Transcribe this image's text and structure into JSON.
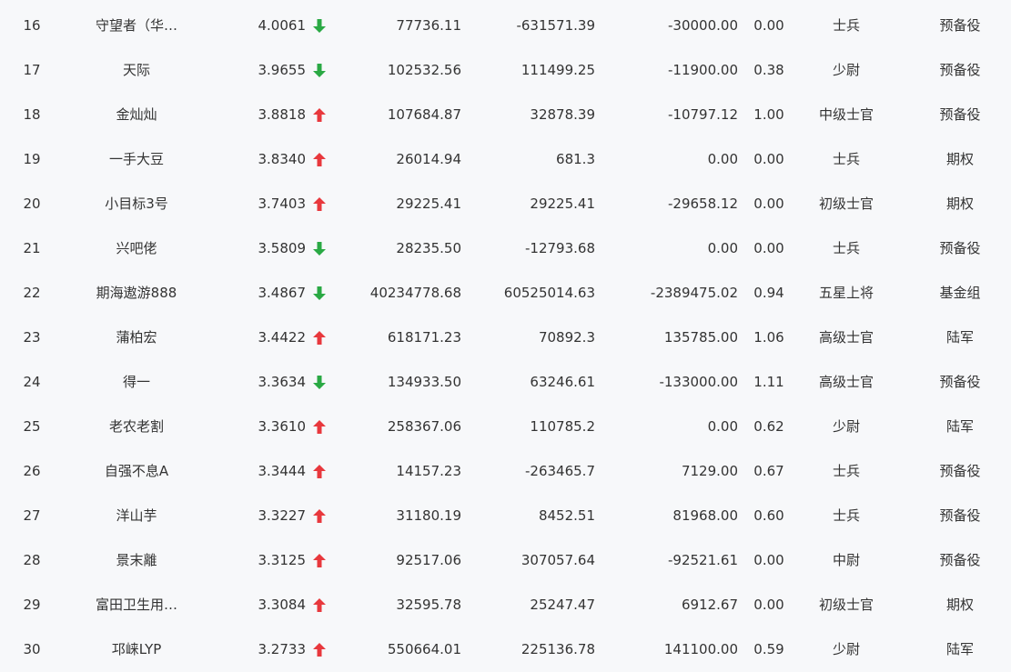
{
  "colors": {
    "up": "#e8383d",
    "down": "#2aa944",
    "text": "#333333",
    "background": "#f7f8fa"
  },
  "rows": [
    {
      "rank": "16",
      "name": "守望者（华…",
      "score": "4.0061",
      "trend": "down",
      "v1": "77736.11",
      "v2": "-631571.39",
      "v3": "-30000.00",
      "ratio": "0.00",
      "title": "士兵",
      "group": "预备役"
    },
    {
      "rank": "17",
      "name": "天际",
      "score": "3.9655",
      "trend": "down",
      "v1": "102532.56",
      "v2": "111499.25",
      "v3": "-11900.00",
      "ratio": "0.38",
      "title": "少尉",
      "group": "预备役"
    },
    {
      "rank": "18",
      "name": "金灿灿",
      "score": "3.8818",
      "trend": "up",
      "v1": "107684.87",
      "v2": "32878.39",
      "v3": "-10797.12",
      "ratio": "1.00",
      "title": "中级士官",
      "group": "预备役"
    },
    {
      "rank": "19",
      "name": "一手大豆",
      "score": "3.8340",
      "trend": "up",
      "v1": "26014.94",
      "v2": "681.3",
      "v3": "0.00",
      "ratio": "0.00",
      "title": "士兵",
      "group": "期权"
    },
    {
      "rank": "20",
      "name": "小目标3号",
      "score": "3.7403",
      "trend": "up",
      "v1": "29225.41",
      "v2": "29225.41",
      "v3": "-29658.12",
      "ratio": "0.00",
      "title": "初级士官",
      "group": "期权"
    },
    {
      "rank": "21",
      "name": "兴吧佬",
      "score": "3.5809",
      "trend": "down",
      "v1": "28235.50",
      "v2": "-12793.68",
      "v3": "0.00",
      "ratio": "0.00",
      "title": "士兵",
      "group": "预备役"
    },
    {
      "rank": "22",
      "name": "期海遨游888",
      "score": "3.4867",
      "trend": "down",
      "v1": "40234778.68",
      "v2": "60525014.63",
      "v3": "-2389475.02",
      "ratio": "0.94",
      "title": "五星上将",
      "group": "基金组"
    },
    {
      "rank": "23",
      "name": "蒲柏宏",
      "score": "3.4422",
      "trend": "up",
      "v1": "618171.23",
      "v2": "70892.3",
      "v3": "135785.00",
      "ratio": "1.06",
      "title": "高级士官",
      "group": "陆军"
    },
    {
      "rank": "24",
      "name": "得一",
      "score": "3.3634",
      "trend": "down",
      "v1": "134933.50",
      "v2": "63246.61",
      "v3": "-133000.00",
      "ratio": "1.11",
      "title": "高级士官",
      "group": "预备役"
    },
    {
      "rank": "25",
      "name": "老农老割",
      "score": "3.3610",
      "trend": "up",
      "v1": "258367.06",
      "v2": "110785.2",
      "v3": "0.00",
      "ratio": "0.62",
      "title": "少尉",
      "group": "陆军"
    },
    {
      "rank": "26",
      "name": "自强不息A",
      "score": "3.3444",
      "trend": "up",
      "v1": "14157.23",
      "v2": "-263465.7",
      "v3": "7129.00",
      "ratio": "0.67",
      "title": "士兵",
      "group": "预备役"
    },
    {
      "rank": "27",
      "name": "洋山芋",
      "score": "3.3227",
      "trend": "up",
      "v1": "31180.19",
      "v2": "8452.51",
      "v3": "81968.00",
      "ratio": "0.60",
      "title": "士兵",
      "group": "预备役"
    },
    {
      "rank": "28",
      "name": "景末離",
      "score": "3.3125",
      "trend": "up",
      "v1": "92517.06",
      "v2": "307057.64",
      "v3": "-92521.61",
      "ratio": "0.00",
      "title": "中尉",
      "group": "预备役"
    },
    {
      "rank": "29",
      "name": "富田卫生用…",
      "score": "3.3084",
      "trend": "up",
      "v1": "32595.78",
      "v2": "25247.47",
      "v3": "6912.67",
      "ratio": "0.00",
      "title": "初级士官",
      "group": "期权"
    },
    {
      "rank": "30",
      "name": "邛崃LYP",
      "score": "3.2733",
      "trend": "up",
      "v1": "550664.01",
      "v2": "225136.78",
      "v3": "141100.00",
      "ratio": "0.59",
      "title": "少尉",
      "group": "陆军"
    }
  ]
}
